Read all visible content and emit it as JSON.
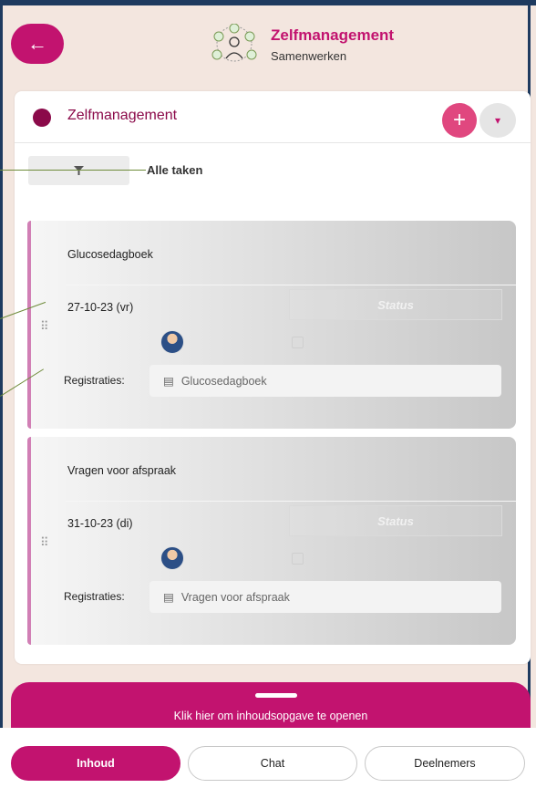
{
  "header": {
    "title": "Zelfmanagement",
    "subtitle": "Samenwerken",
    "back_icon": "arrow-left-icon"
  },
  "card": {
    "title": "Zelfmanagement",
    "plus_label": "+",
    "caret_label": "▾",
    "filter_icon": "filter-icon",
    "filter_label": "Alle taken"
  },
  "tasks": [
    {
      "name": "Glucosedagboek",
      "date": "27-10-23 (vr)",
      "status_placeholder": "Status",
      "registraties_label": "Registraties:",
      "registratie": "Glucosedagboek"
    },
    {
      "name": "Vragen voor afspraak",
      "date": "31-10-23 (di)",
      "status_placeholder": "Status",
      "registraties_label": "Registraties:",
      "registratie": "Vragen voor afspraak"
    }
  ],
  "drawer": {
    "text": "Klik hier om inhoudsopgave te openen"
  },
  "tabs": [
    {
      "label": "Inhoud",
      "active": true
    },
    {
      "label": "Chat",
      "active": false
    },
    {
      "label": "Deelnemers",
      "active": false
    }
  ],
  "colors": {
    "brand": "#c2136f",
    "accent": "#e0477f",
    "task_border": "#d17fb5",
    "annotation_line": "#6e8b3a"
  }
}
